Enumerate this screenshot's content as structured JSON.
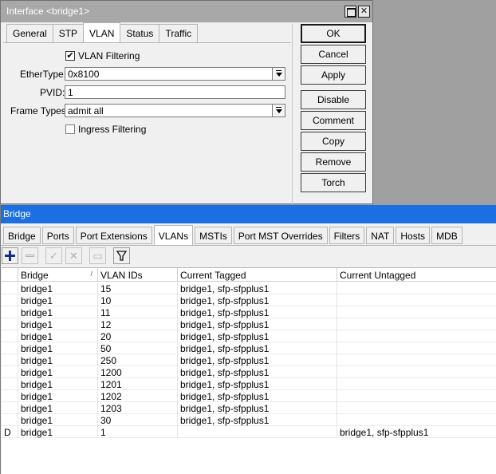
{
  "interface_window": {
    "title": "Interface <bridge1>",
    "tabs": [
      "General",
      "STP",
      "VLAN",
      "Status",
      "Traffic"
    ],
    "active_tab": "VLAN",
    "vlan_filtering": {
      "label": "VLAN Filtering",
      "checked": true
    },
    "ether_type": {
      "label": "EtherType:",
      "value": "0x8100"
    },
    "pvid": {
      "label": "PVID:",
      "value": "1"
    },
    "frame_types": {
      "label": "Frame Types:",
      "value": "admit all"
    },
    "ingress_filtering": {
      "label": "Ingress Filtering",
      "checked": false
    },
    "buttons": {
      "ok": "OK",
      "cancel": "Cancel",
      "apply": "Apply",
      "disable": "Disable",
      "comment": "Comment",
      "copy": "Copy",
      "remove": "Remove",
      "torch": "Torch"
    }
  },
  "bridge_window": {
    "title": "Bridge",
    "tabs": [
      "Bridge",
      "Ports",
      "Port Extensions",
      "VLANs",
      "MSTIs",
      "Port MST Overrides",
      "Filters",
      "NAT",
      "Hosts",
      "MDB"
    ],
    "active_tab": "VLANs",
    "toolbar": [
      "add-icon",
      "remove-icon",
      "enable-icon",
      "disable-icon",
      "comment-icon",
      "filter-icon"
    ],
    "columns": [
      "",
      "Bridge",
      "VLAN IDs",
      "Current Tagged",
      "Current Untagged"
    ],
    "rows": [
      {
        "flag": "",
        "bridge": "bridge1",
        "vlan_ids": "15",
        "current_tagged": "bridge1, sfp-sfpplus1",
        "current_untagged": ""
      },
      {
        "flag": "",
        "bridge": "bridge1",
        "vlan_ids": "10",
        "current_tagged": "bridge1, sfp-sfpplus1",
        "current_untagged": ""
      },
      {
        "flag": "",
        "bridge": "bridge1",
        "vlan_ids": "11",
        "current_tagged": "bridge1, sfp-sfpplus1",
        "current_untagged": ""
      },
      {
        "flag": "",
        "bridge": "bridge1",
        "vlan_ids": "12",
        "current_tagged": "bridge1, sfp-sfpplus1",
        "current_untagged": ""
      },
      {
        "flag": "",
        "bridge": "bridge1",
        "vlan_ids": "20",
        "current_tagged": "bridge1, sfp-sfpplus1",
        "current_untagged": ""
      },
      {
        "flag": "",
        "bridge": "bridge1",
        "vlan_ids": "50",
        "current_tagged": "bridge1, sfp-sfpplus1",
        "current_untagged": ""
      },
      {
        "flag": "",
        "bridge": "bridge1",
        "vlan_ids": "250",
        "current_tagged": "bridge1, sfp-sfpplus1",
        "current_untagged": ""
      },
      {
        "flag": "",
        "bridge": "bridge1",
        "vlan_ids": "1200",
        "current_tagged": "bridge1, sfp-sfpplus1",
        "current_untagged": ""
      },
      {
        "flag": "",
        "bridge": "bridge1",
        "vlan_ids": "1201",
        "current_tagged": "bridge1, sfp-sfpplus1",
        "current_untagged": ""
      },
      {
        "flag": "",
        "bridge": "bridge1",
        "vlan_ids": "1202",
        "current_tagged": "bridge1, sfp-sfpplus1",
        "current_untagged": ""
      },
      {
        "flag": "",
        "bridge": "bridge1",
        "vlan_ids": "1203",
        "current_tagged": "bridge1, sfp-sfpplus1",
        "current_untagged": ""
      },
      {
        "flag": "",
        "bridge": "bridge1",
        "vlan_ids": "30",
        "current_tagged": "bridge1, sfp-sfpplus1",
        "current_untagged": ""
      },
      {
        "flag": "D",
        "bridge": "bridge1",
        "vlan_ids": "1",
        "current_tagged": "",
        "current_untagged": "bridge1, sfp-sfpplus1"
      }
    ]
  }
}
